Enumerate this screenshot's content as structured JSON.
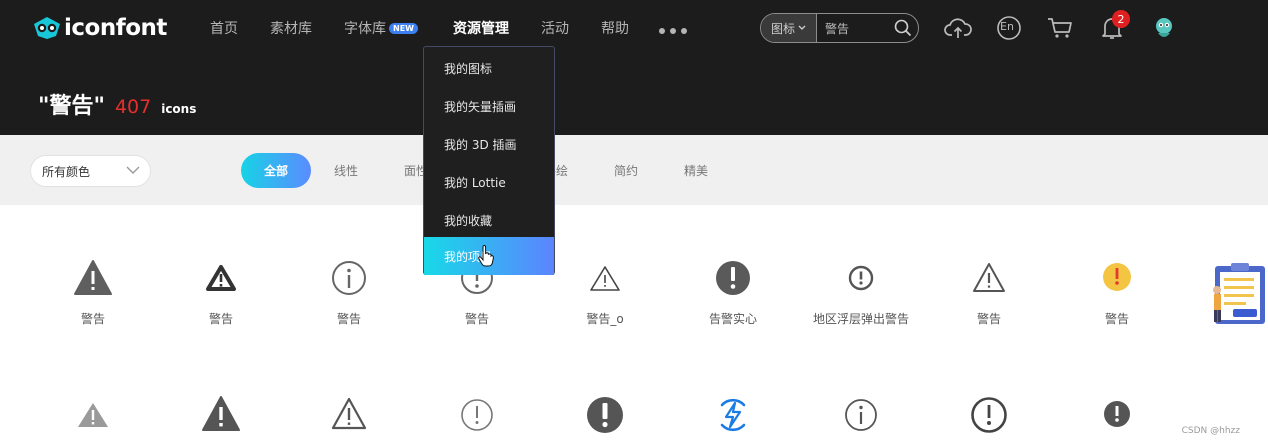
{
  "brand": {
    "name": "iconfont"
  },
  "nav": {
    "items": [
      {
        "label": "首页"
      },
      {
        "label": "素材库"
      },
      {
        "label": "字体库",
        "badge": "NEW"
      },
      {
        "label": "资源管理",
        "active": true
      },
      {
        "label": "活动"
      },
      {
        "label": "帮助"
      }
    ],
    "more_icon": "more-dots-icon"
  },
  "search": {
    "type_label": "图标",
    "value": "警告",
    "icon": "search-icon"
  },
  "header_icons": {
    "upload": "cloud-upload-icon",
    "language": "En",
    "cart": "cart-icon",
    "notifications": "bell-icon",
    "notification_count": "2",
    "avatar": "avatar-icon"
  },
  "result": {
    "keyword": "\"警告\"",
    "count": "407",
    "unit": "icons"
  },
  "filter": {
    "color_select": "所有颜色",
    "tabs": [
      {
        "label": "全部",
        "active": true
      },
      {
        "label": "线性"
      },
      {
        "label": "面性"
      },
      {
        "label": "手绘"
      },
      {
        "label": "简约"
      },
      {
        "label": "精美"
      }
    ]
  },
  "dropdown": {
    "items": [
      {
        "label": "我的图标"
      },
      {
        "label": "我的矢量插画"
      },
      {
        "label": "我的 3D 插画"
      },
      {
        "label": "我的 Lottie"
      },
      {
        "label": "我的收藏"
      },
      {
        "label": "我的项目",
        "active": true
      }
    ]
  },
  "icons_row1": [
    {
      "label": "警告",
      "icon": "warning-triangle-filled-icon"
    },
    {
      "label": "警告",
      "icon": "warning-triangle-bold-icon"
    },
    {
      "label": "警告",
      "icon": "info-circle-outline-icon"
    },
    {
      "label": "警告",
      "icon": "alert-circle-outline-icon"
    },
    {
      "label": "警告_o",
      "icon": "warning-triangle-outline-icon"
    },
    {
      "label": "告警实心",
      "icon": "alert-circle-filled-icon"
    },
    {
      "label": "地区浮层弹出警告",
      "icon": "alert-circle-small-icon"
    },
    {
      "label": "警告",
      "icon": "warning-triangle-outline-icon"
    },
    {
      "label": "警告",
      "icon": "alert-circle-yellow-icon"
    }
  ],
  "icons_row2": [
    {
      "icon": "warning-triangle-gray-icon"
    },
    {
      "icon": "warning-triangle-filled-icon"
    },
    {
      "icon": "warning-triangle-outline-icon"
    },
    {
      "icon": "alert-circle-outline-icon"
    },
    {
      "icon": "alert-circle-filled-icon"
    },
    {
      "icon": "lightning-circle-blue-icon"
    },
    {
      "icon": "info-circle-outline-icon"
    },
    {
      "icon": "alert-circle-outline-bold-icon"
    },
    {
      "icon": "alert-circle-filled-small-icon"
    }
  ],
  "colors": {
    "header_bg": "#1c1c1c",
    "accent_start": "#17d3e6",
    "accent_end": "#5b8bff",
    "count_red": "#e62e2e"
  },
  "watermark": "CSDN @hhzz"
}
